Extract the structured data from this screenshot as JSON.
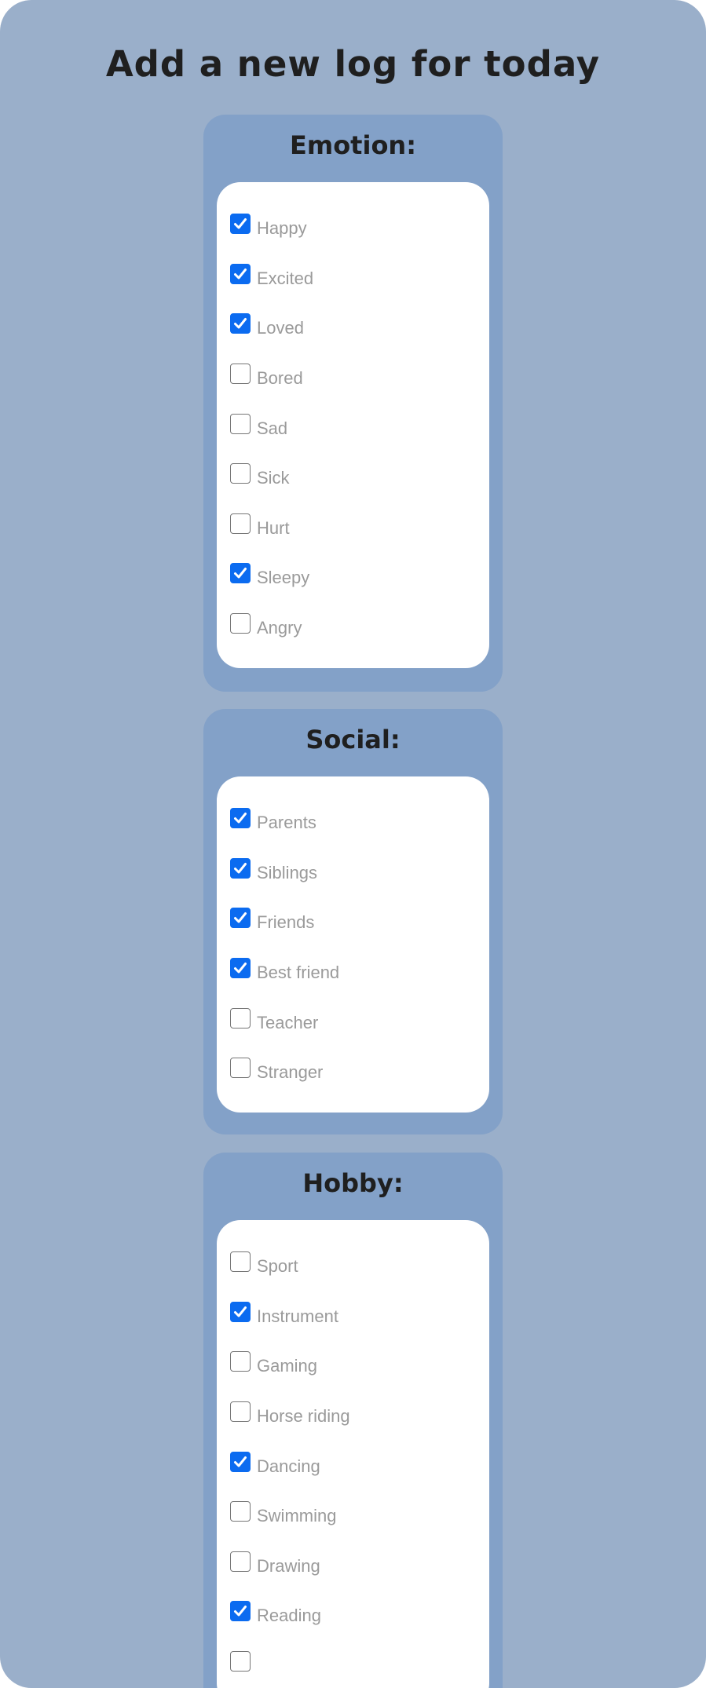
{
  "page": {
    "title": "Add a new log for today"
  },
  "colors": {
    "background": "#9aafca",
    "section_background": "#83a1c8",
    "card_background": "#ffffff",
    "checkbox_checked": "#0b6bf0",
    "label_text": "#9a9a9a",
    "title_text": "#1f1f1f"
  },
  "sections": [
    {
      "title": "Emotion:",
      "items": [
        {
          "label": "Happy",
          "checked": true
        },
        {
          "label": "Excited",
          "checked": true
        },
        {
          "label": "Loved",
          "checked": true
        },
        {
          "label": "Bored",
          "checked": false
        },
        {
          "label": "Sad",
          "checked": false
        },
        {
          "label": "Sick",
          "checked": false
        },
        {
          "label": "Hurt",
          "checked": false
        },
        {
          "label": "Sleepy",
          "checked": true
        },
        {
          "label": "Angry",
          "checked": false
        }
      ]
    },
    {
      "title": "Social:",
      "items": [
        {
          "label": "Parents",
          "checked": true
        },
        {
          "label": "Siblings",
          "checked": true
        },
        {
          "label": "Friends",
          "checked": true
        },
        {
          "label": "Best friend",
          "checked": true
        },
        {
          "label": "Teacher",
          "checked": false
        },
        {
          "label": "Stranger",
          "checked": false
        }
      ]
    },
    {
      "title": "Hobby:",
      "items": [
        {
          "label": "Sport",
          "checked": false
        },
        {
          "label": "Instrument",
          "checked": true
        },
        {
          "label": "Gaming",
          "checked": false
        },
        {
          "label": "Horse riding",
          "checked": false
        },
        {
          "label": "Dancing",
          "checked": true
        },
        {
          "label": "Swimming",
          "checked": false
        },
        {
          "label": "Drawing",
          "checked": false
        },
        {
          "label": "Reading",
          "checked": true
        },
        {
          "label": "",
          "checked": false
        }
      ]
    }
  ]
}
